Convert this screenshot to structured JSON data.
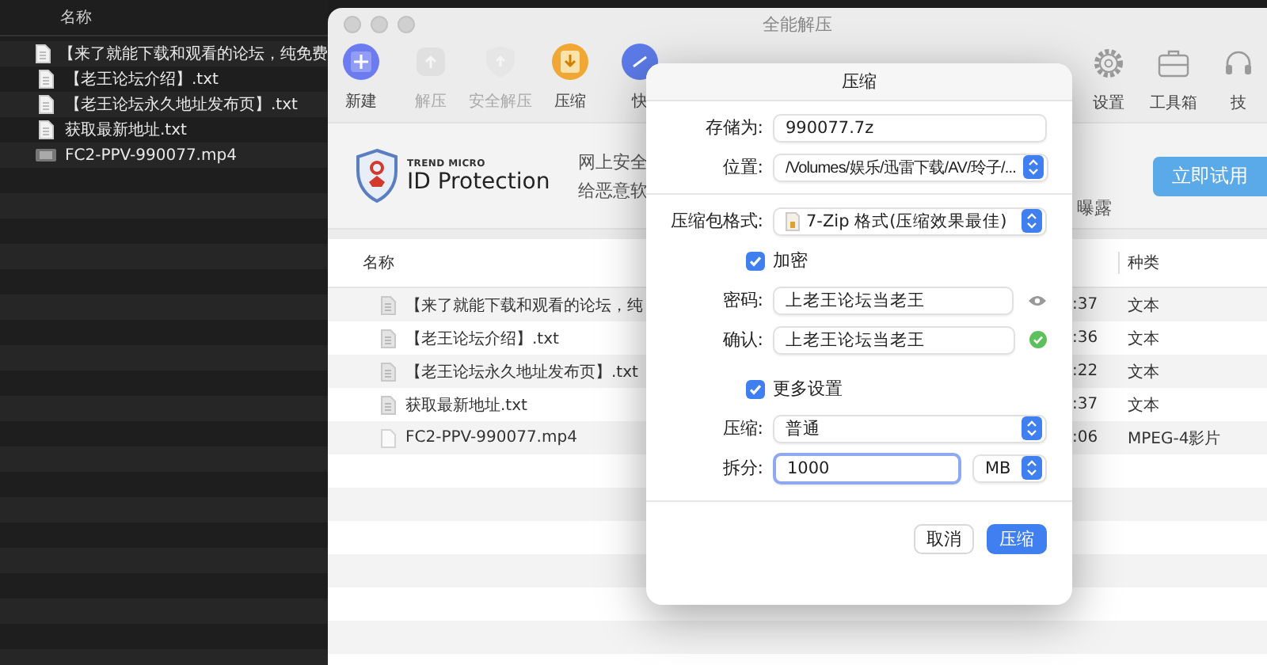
{
  "finder": {
    "column": "名称",
    "files": [
      {
        "name": "【来了就能下载和观看的论坛，纯免费",
        "kind": "text"
      },
      {
        "name": "【老王论坛介绍】.txt",
        "kind": "text"
      },
      {
        "name": "【老王论坛永久地址发布页】.txt",
        "kind": "text"
      },
      {
        "name": "获取最新地址.txt",
        "kind": "text"
      },
      {
        "name": "FC2-PPV-990077.mp4",
        "kind": "video"
      }
    ]
  },
  "app": {
    "title": "全能解压",
    "toolbar": [
      {
        "label": "新建",
        "kind": "new",
        "disabled": false
      },
      {
        "label": "解压",
        "kind": "extract",
        "disabled": true
      },
      {
        "label": "安全解压",
        "kind": "safe",
        "disabled": true
      },
      {
        "label": "压缩",
        "kind": "compress",
        "disabled": false
      },
      {
        "label": "快",
        "kind": "quick",
        "disabled": false
      }
    ],
    "toolbar_right": [
      {
        "label": "设置",
        "kind": "settings"
      },
      {
        "label": "工具箱",
        "kind": "toolbox"
      },
      {
        "label": "技",
        "kind": "support"
      }
    ],
    "ad": {
      "brand_small": "TREND MICRO",
      "brand": "ID Protection",
      "lines": [
        "网上安全",
        "给恶意软"
      ],
      "tail": "曝露",
      "button": "立即试用"
    },
    "table": {
      "columns": [
        "名称",
        "种类"
      ],
      "rows": [
        {
          "name": "【来了就能下载和观看的论坛，纯",
          "time": ":37",
          "type": "文本",
          "kind": "text"
        },
        {
          "name": "【老王论坛介绍】.txt",
          "time": ":36",
          "type": "文本",
          "kind": "text"
        },
        {
          "name": "【老王论坛永久地址发布页】.txt",
          "time": ":22",
          "type": "文本",
          "kind": "text"
        },
        {
          "name": "获取最新地址.txt",
          "time": ":37",
          "type": "文本",
          "kind": "text"
        },
        {
          "name": "FC2-PPV-990077.mp4",
          "time": ":06",
          "type": "MPEG-4影片",
          "kind": "video"
        }
      ]
    }
  },
  "dialog": {
    "title": "压缩",
    "save_as": {
      "label": "存储为:",
      "value": "990077.7z"
    },
    "location": {
      "label": "位置:",
      "value": "/Volumes/娱乐/迅雷下载/AV/玲子/..."
    },
    "format": {
      "label": "压缩包格式:",
      "value": "7-Zip 格式(压缩效果最佳)"
    },
    "encrypt": {
      "label": "加密",
      "checked": true
    },
    "password": {
      "label": "密码:",
      "value": "上老王论坛当老王"
    },
    "confirm": {
      "label": "确认:",
      "value": "上老王论坛当老王",
      "matched": true
    },
    "more": {
      "label": "更多设置",
      "checked": true
    },
    "level": {
      "label": "压缩:",
      "value": "普通"
    },
    "split": {
      "label": "拆分:",
      "value": "1000",
      "unit": "MB",
      "focused": true
    },
    "buttons": [
      {
        "label": "取消",
        "kind": "cancel"
      },
      {
        "label": "压缩",
        "kind": "primary"
      }
    ]
  }
}
